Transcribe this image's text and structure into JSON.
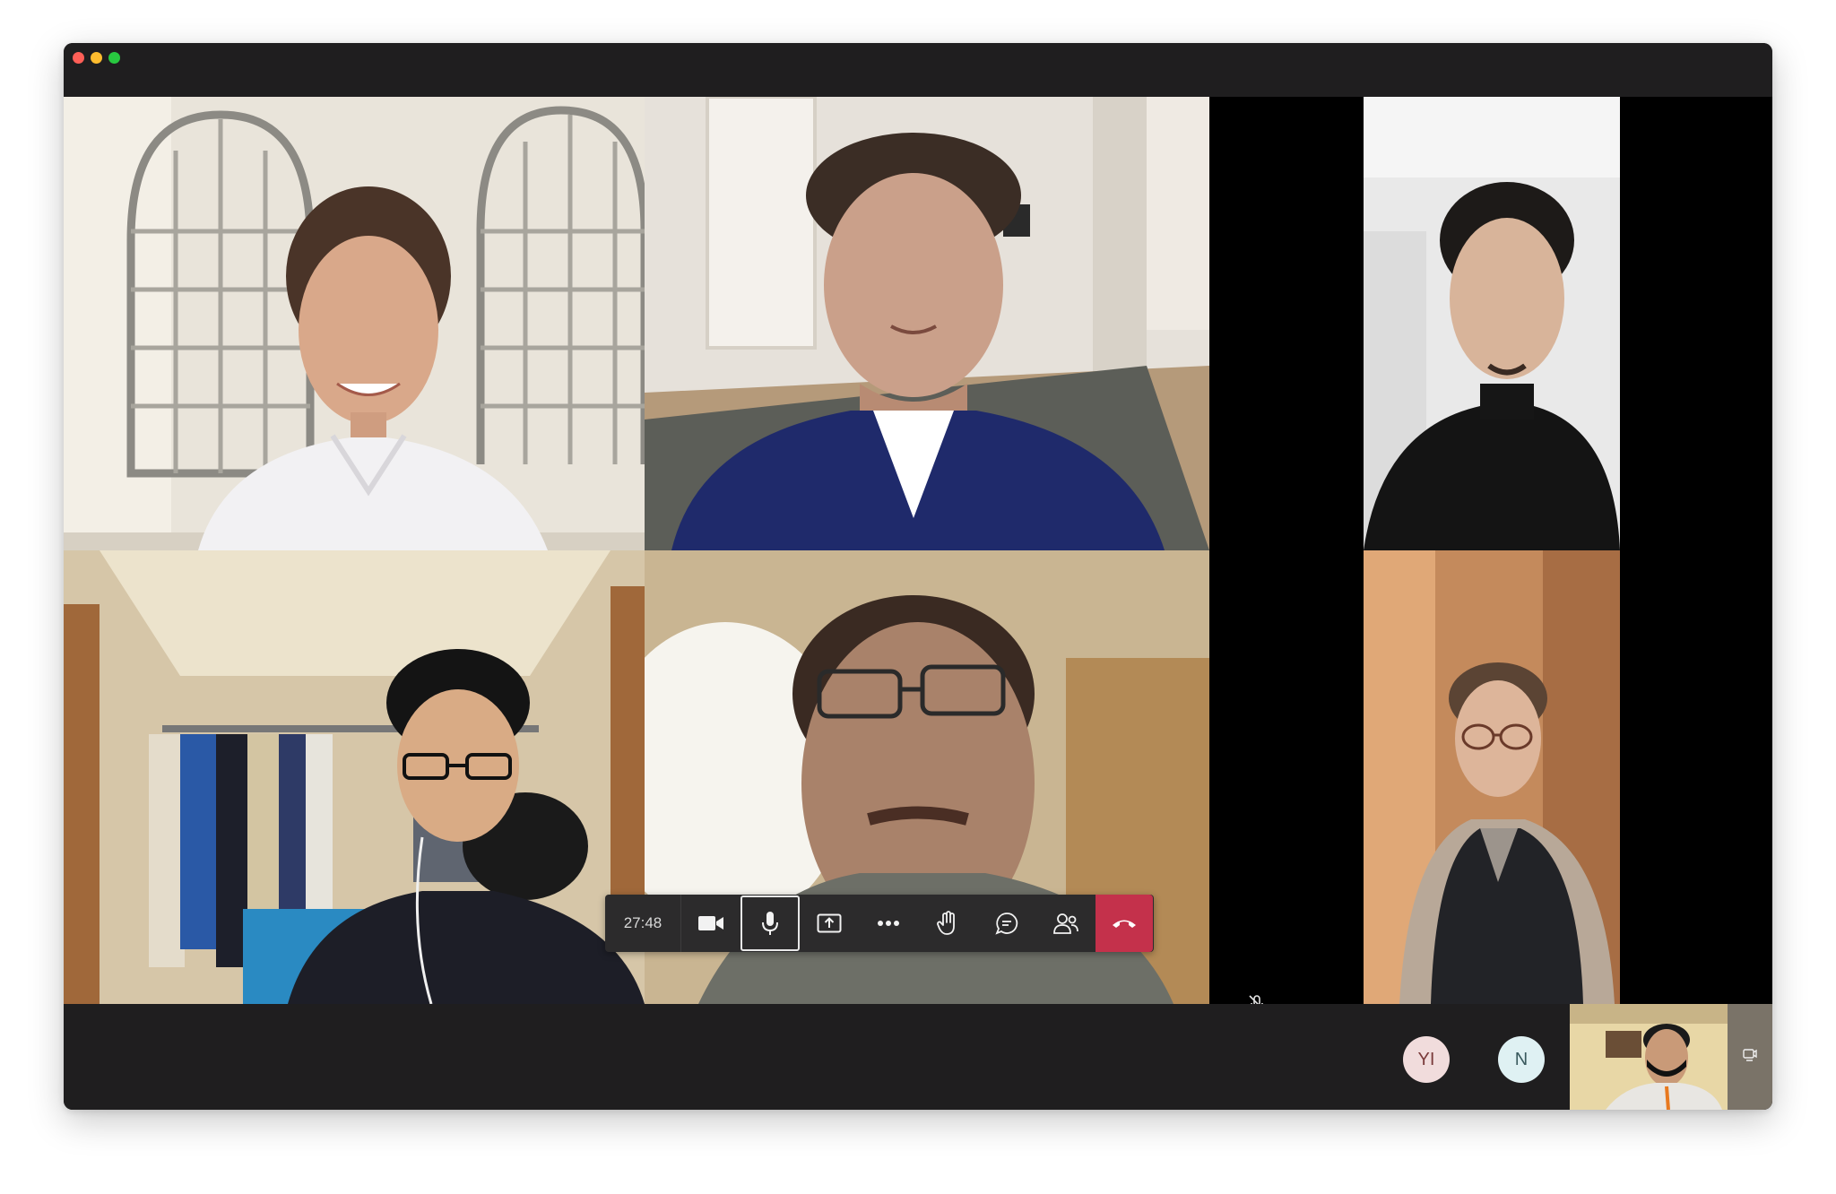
{
  "call": {
    "timer": "27:48"
  },
  "controls": {
    "camera": "camera-icon",
    "mic": "microphone-icon",
    "share": "share-screen-icon",
    "more": "more-options-icon",
    "raise_hand": "raise-hand-icon",
    "chat": "chat-icon",
    "participants": "participants-icon",
    "hangup": "hang-up-icon"
  },
  "participants": {
    "initials": [
      "YI",
      "N"
    ]
  },
  "colors": {
    "hangup": "#c4314b",
    "window_bg": "#1f1e1f",
    "avatar_yi": "#f1dcdc",
    "avatar_n": "#dff1f3"
  }
}
